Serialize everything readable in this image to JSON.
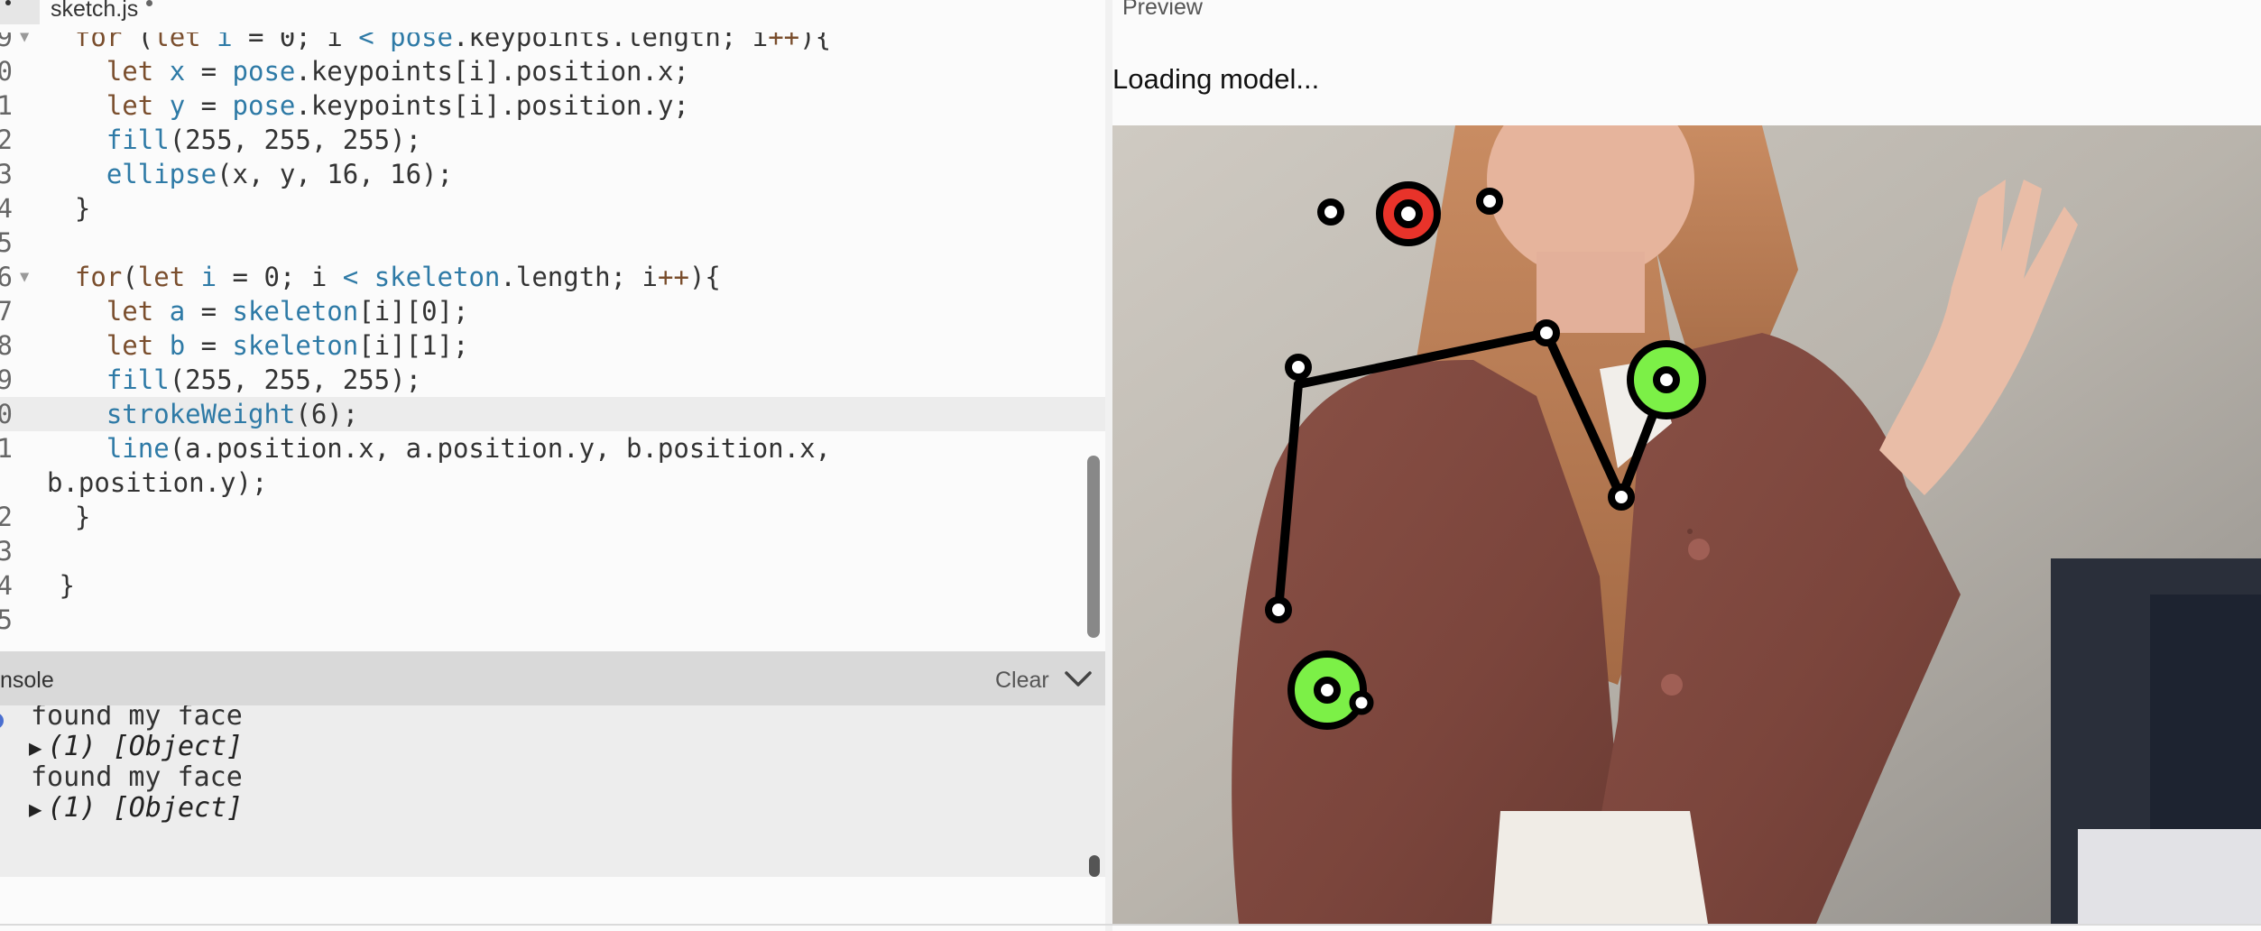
{
  "editor": {
    "tab_label": "sketch.js",
    "lines": [
      {
        "num": "9",
        "fold": true,
        "parts": [
          [
            "pl",
            "  "
          ],
          [
            "kw",
            "for"
          ],
          [
            "pl",
            " ("
          ],
          [
            "kw",
            "let"
          ],
          [
            "fn",
            " i"
          ],
          [
            "pl",
            " = 0; i "
          ],
          [
            "fn",
            "<"
          ],
          [
            "pl",
            " "
          ],
          [
            "fn",
            "pose"
          ],
          [
            "pl",
            ".keypoints.length; i"
          ],
          [
            "kw",
            "++"
          ],
          [
            "pl",
            "){"
          ]
        ]
      },
      {
        "num": "0",
        "parts": [
          [
            "pl",
            "    "
          ],
          [
            "kw",
            "let"
          ],
          [
            "fn",
            " x"
          ],
          [
            "pl",
            " = "
          ],
          [
            "fn",
            "pose"
          ],
          [
            "pl",
            ".keypoints[i].position.x;"
          ]
        ]
      },
      {
        "num": "1",
        "parts": [
          [
            "pl",
            "    "
          ],
          [
            "kw",
            "let"
          ],
          [
            "fn",
            " y"
          ],
          [
            "pl",
            " = "
          ],
          [
            "fn",
            "pose"
          ],
          [
            "pl",
            ".keypoints[i].position.y;"
          ]
        ]
      },
      {
        "num": "2",
        "parts": [
          [
            "pl",
            "    "
          ],
          [
            "fn",
            "fill"
          ],
          [
            "pl",
            "(255, 255, 255);"
          ]
        ]
      },
      {
        "num": "3",
        "parts": [
          [
            "pl",
            "    "
          ],
          [
            "fn",
            "ellipse"
          ],
          [
            "pl",
            "(x, y, 16, 16);"
          ]
        ]
      },
      {
        "num": "4",
        "parts": [
          [
            "pl",
            "  }"
          ]
        ]
      },
      {
        "num": "5",
        "parts": [
          [
            "pl",
            ""
          ]
        ]
      },
      {
        "num": "6",
        "fold": true,
        "parts": [
          [
            "pl",
            "  "
          ],
          [
            "kw",
            "for"
          ],
          [
            "pl",
            "("
          ],
          [
            "kw",
            "let"
          ],
          [
            "fn",
            " i"
          ],
          [
            "pl",
            " = 0; i "
          ],
          [
            "fn",
            "<"
          ],
          [
            "pl",
            " "
          ],
          [
            "fn",
            "skeleton"
          ],
          [
            "pl",
            ".length; i"
          ],
          [
            "kw",
            "++"
          ],
          [
            "pl",
            "){"
          ]
        ]
      },
      {
        "num": "7",
        "parts": [
          [
            "pl",
            "    "
          ],
          [
            "kw",
            "let"
          ],
          [
            "fn",
            " a"
          ],
          [
            "pl",
            " = "
          ],
          [
            "fn",
            "skeleton"
          ],
          [
            "pl",
            "[i][0];"
          ]
        ]
      },
      {
        "num": "8",
        "parts": [
          [
            "pl",
            "    "
          ],
          [
            "kw",
            "let"
          ],
          [
            "fn",
            " b"
          ],
          [
            "pl",
            " = "
          ],
          [
            "fn",
            "skeleton"
          ],
          [
            "pl",
            "[i][1];"
          ]
        ]
      },
      {
        "num": "9",
        "parts": [
          [
            "pl",
            "    "
          ],
          [
            "fn",
            "fill"
          ],
          [
            "pl",
            "(255, 255, 255);"
          ]
        ]
      },
      {
        "num": "0",
        "active": true,
        "parts": [
          [
            "pl",
            "    "
          ],
          [
            "fn",
            "strokeWeight"
          ],
          [
            "pl",
            "(6);"
          ]
        ]
      },
      {
        "num": "1",
        "parts": [
          [
            "pl",
            "    "
          ],
          [
            "fn",
            "line"
          ],
          [
            "pl",
            "(a.position.x, a.position.y, b.position.x,"
          ]
        ]
      },
      {
        "num": "",
        "cont": true,
        "parts": [
          [
            "pl",
            "b.position.y);"
          ]
        ]
      },
      {
        "num": "2",
        "parts": [
          [
            "pl",
            "  }"
          ]
        ]
      },
      {
        "num": "3",
        "parts": [
          [
            "pl",
            ""
          ]
        ]
      },
      {
        "num": "4",
        "parts": [
          [
            "pl",
            " }"
          ]
        ]
      },
      {
        "num": "5",
        "parts": [
          [
            "pl",
            ""
          ]
        ]
      }
    ]
  },
  "console": {
    "title": "nsole",
    "clear_label": "Clear",
    "entries": [
      {
        "type": "log",
        "text": "found my face"
      },
      {
        "type": "object",
        "text": "(1) [Object]"
      },
      {
        "type": "log",
        "text": "found my face"
      },
      {
        "type": "object",
        "text": "(1) [Object]"
      }
    ]
  },
  "preview": {
    "label": "Preview",
    "status_text": "Loading model..."
  },
  "icons": {
    "fold": "fold-arrow-icon",
    "expand": "disclosure-triangle-icon",
    "collapse": "chevron-down-icon"
  },
  "colors": {
    "keyword": "#7a4e2d",
    "identifier": "#2e7aa6",
    "nose_marker": "#e8332a",
    "wrist_marker": "#7cf047"
  }
}
